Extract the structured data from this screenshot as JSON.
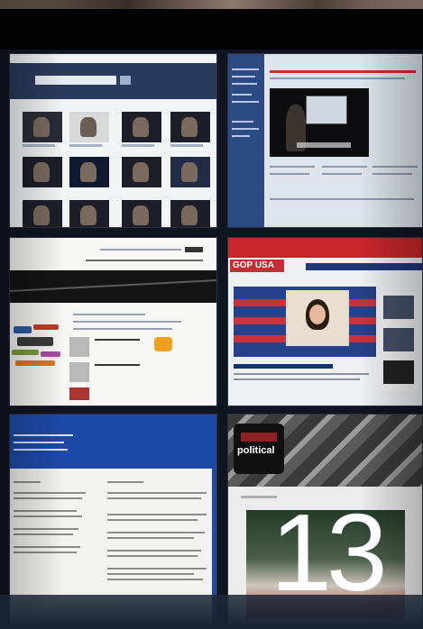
{
  "thumbnails": [
    {
      "id": "video-gallery",
      "description": ""
    },
    {
      "id": "lecture-video",
      "description": ""
    },
    {
      "id": "blog-page",
      "description": ""
    },
    {
      "id": "gop-usa",
      "logo_text": "GOP USA",
      "headline": "Public Attitudes Toward Guns"
    },
    {
      "id": "blue-document",
      "description": ""
    },
    {
      "id": "political-site",
      "badge_text": "political"
    }
  ],
  "page_number": "13",
  "colors": {
    "background": "#05070c",
    "gop_red": "#c9262b",
    "gop_blue": "#27408a",
    "doc_blue": "#1d4aa8",
    "page_number": "#ffffff"
  }
}
